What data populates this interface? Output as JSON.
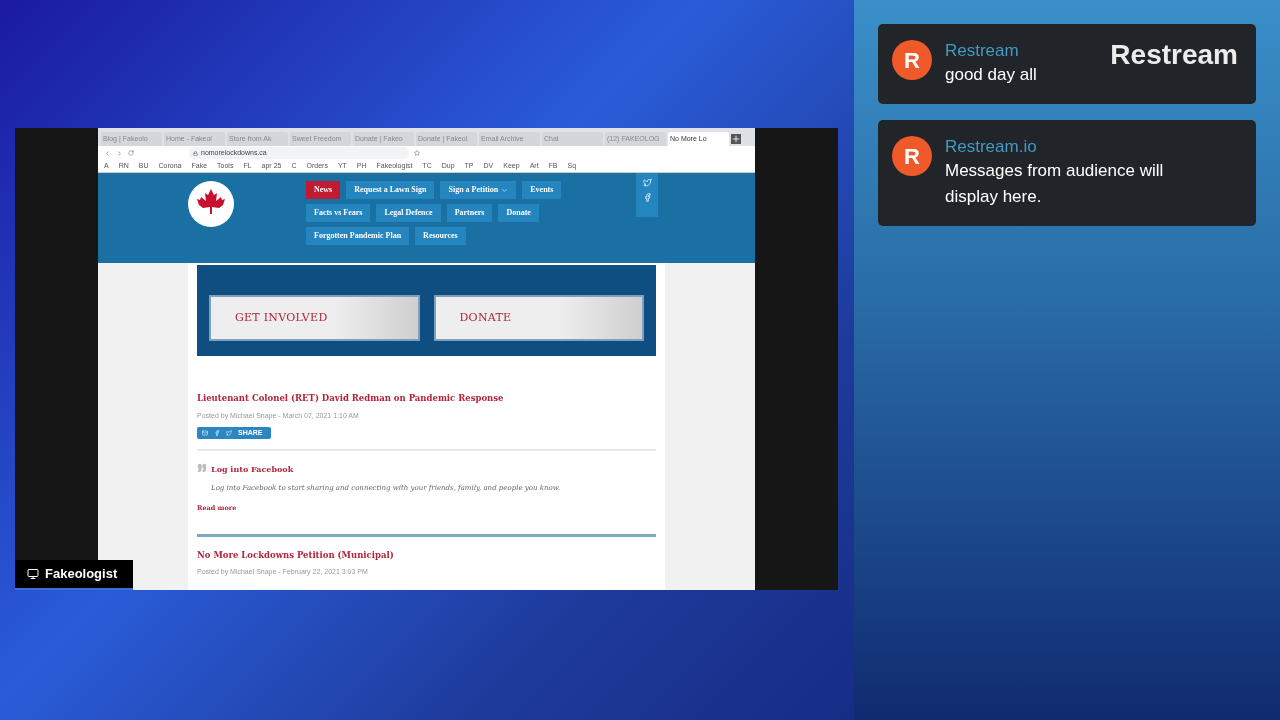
{
  "browser": {
    "tabs": [
      {
        "title": "Blog | Fakeolo",
        "selected": false
      },
      {
        "title": "Home - Fakeol",
        "selected": false
      },
      {
        "title": "Store from Ak",
        "selected": false
      },
      {
        "title": "Sweet Freedom",
        "selected": false
      },
      {
        "title": "Donate | Fakeo",
        "selected": false
      },
      {
        "title": "Donate | Fakeol",
        "selected": false
      },
      {
        "title": "Email Archive",
        "selected": false
      },
      {
        "title": "Chat",
        "selected": false
      },
      {
        "title": "(12) FAKEOLOG",
        "selected": false
      },
      {
        "title": "No More Lo",
        "selected": true
      }
    ],
    "url": "nomorelockdowns.ca",
    "bookmarks": [
      "A",
      "RN",
      "BU",
      "Corona",
      "Fake",
      "Tools",
      "FL",
      "apr 25",
      "C",
      "Orders",
      "YT",
      "PH",
      "Fakeologist",
      "TC",
      "Dup",
      "TP",
      "DV",
      "Keep",
      "Art",
      "FB",
      "Sq"
    ]
  },
  "site": {
    "nav": [
      {
        "label": "News",
        "selected": true,
        "dropdown": false
      },
      {
        "label": "Request a Lawn Sign",
        "selected": false,
        "dropdown": false
      },
      {
        "label": "Sign a Petition",
        "selected": false,
        "dropdown": true
      },
      {
        "label": "Events",
        "selected": false,
        "dropdown": false
      },
      {
        "label": "Facts vs Fears",
        "selected": false,
        "dropdown": false
      },
      {
        "label": "Legal Defence",
        "selected": false,
        "dropdown": false
      },
      {
        "label": "Partners",
        "selected": false,
        "dropdown": false
      },
      {
        "label": "Donate",
        "selected": false,
        "dropdown": false
      },
      {
        "label": "Forgotten Pandemic Plan",
        "selected": false,
        "dropdown": false
      },
      {
        "label": "Resources",
        "selected": false,
        "dropdown": false
      }
    ],
    "banners": [
      "GET INVOLVED",
      "DONATE"
    ],
    "posts": [
      {
        "title": "Lieutenant Colonel (RET) David Redman on Pandemic Response",
        "meta": "Posted by Michael Snape - March 07, 2021 1:10 AM",
        "share": "SHARE",
        "quote_title": "Log into Facebook",
        "quote_text": "Log into Facebook to start sharing and connecting with your friends, family, and people you know.",
        "read_more": "Read more"
      },
      {
        "title": "No More Lockdowns Petition (Municipal)",
        "meta": "Posted by Michael Snape - February 22, 2021 3:03 PM"
      }
    ]
  },
  "screen_label": "Fakeologist",
  "logo": "Restream",
  "chat": [
    {
      "avatar": "R",
      "author": "Restream",
      "text": "good day all"
    },
    {
      "avatar": "R",
      "author": "Restream.io",
      "text": "Messages from audience will display here."
    }
  ]
}
